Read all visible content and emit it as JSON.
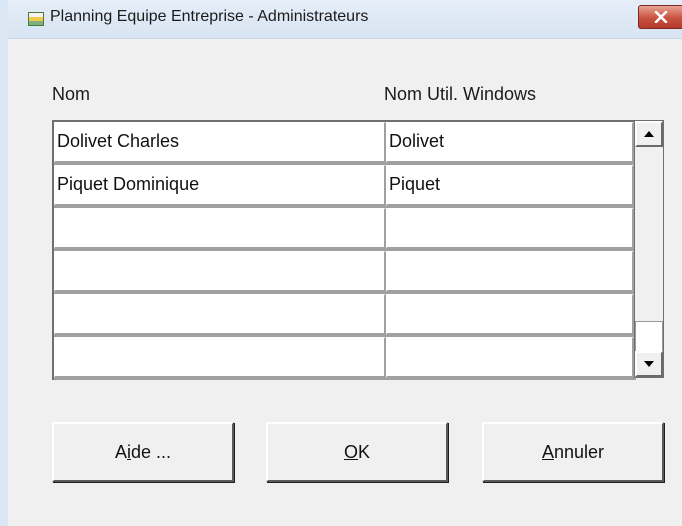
{
  "window": {
    "title": "Planning Equipe Entreprise - Administrateurs"
  },
  "headers": {
    "name": "Nom",
    "windows_user": "Nom Util. Windows"
  },
  "rows": [
    {
      "name": "Dolivet Charles",
      "windows_user": "Dolivet"
    },
    {
      "name": "Piquet Dominique",
      "windows_user": "Piquet"
    },
    {
      "name": "",
      "windows_user": ""
    },
    {
      "name": "",
      "windows_user": ""
    },
    {
      "name": "",
      "windows_user": ""
    },
    {
      "name": "",
      "windows_user": ""
    }
  ],
  "buttons": {
    "help": {
      "pre": "A",
      "mnemonic": "i",
      "post": "de ..."
    },
    "ok": {
      "pre": "",
      "mnemonic": "O",
      "post": "K"
    },
    "cancel": {
      "pre": "",
      "mnemonic": "A",
      "post": "nnuler"
    }
  },
  "icons": {
    "app": "planning-app-icon",
    "close": "close-icon",
    "scroll_up": "arrow-up-icon",
    "scroll_down": "arrow-down-icon"
  },
  "colors": {
    "close_button": "#c8523f",
    "dialog_background": "#f0f0f0",
    "title_bar": "#dbe7f4"
  }
}
